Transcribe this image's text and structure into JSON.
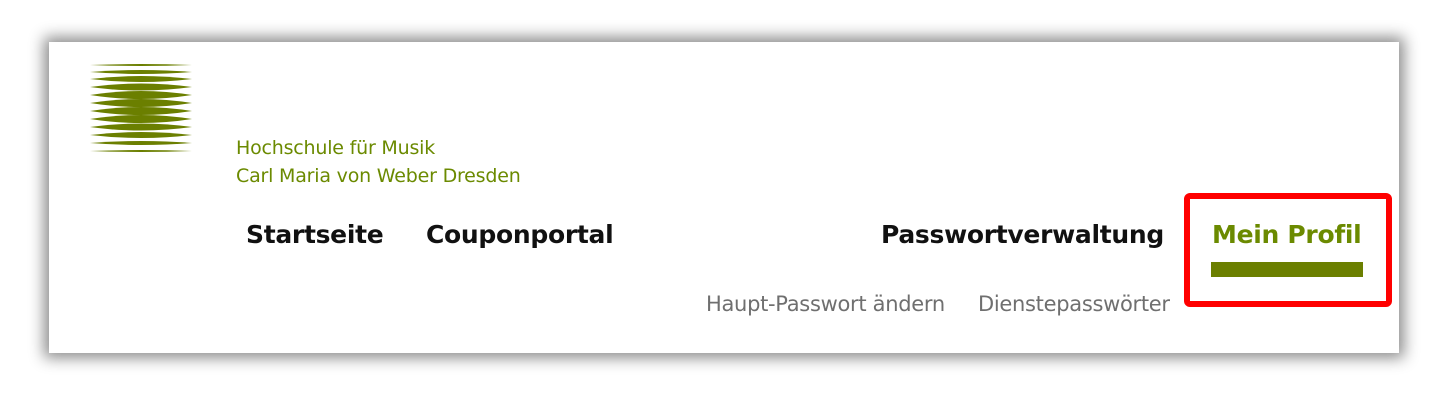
{
  "institution": {
    "line1": "Hochschule für Musik",
    "line2": "Carl Maria von Weber Dresden"
  },
  "nav": {
    "items": [
      {
        "label": "Startseite"
      },
      {
        "label": "Couponportal"
      },
      {
        "label": "Passwortverwaltung"
      },
      {
        "label": "Mein Profil",
        "active": true
      }
    ]
  },
  "subnav": {
    "items": [
      {
        "label": "Haupt-Passwort ändern"
      },
      {
        "label": "Dienstepasswörter"
      }
    ]
  },
  "colors": {
    "brand": "#6b8a00",
    "highlight": "#ff0000",
    "subnav_text": "#6f6f6f"
  },
  "icons": {
    "logo": "striped-lens-logo"
  }
}
